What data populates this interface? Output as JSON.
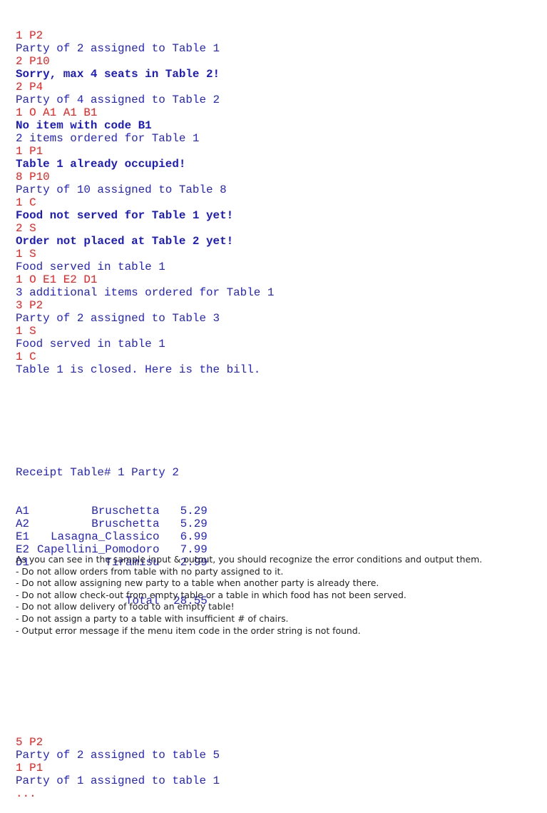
{
  "colors": {
    "input": "#ff1a1a",
    "output": "#2222dd",
    "error": "#1a1acc",
    "notes_text": "#222222"
  },
  "transcript": [
    {
      "type": "in",
      "text": "1 P2"
    },
    {
      "type": "out",
      "text": "Party of 2 assigned to Table 1"
    },
    {
      "type": "in",
      "text": "2 P10"
    },
    {
      "type": "err",
      "text": "Sorry, max 4 seats in Table 2!"
    },
    {
      "type": "in",
      "text": "2 P4"
    },
    {
      "type": "out",
      "text": "Party of 4 assigned to Table 2"
    },
    {
      "type": "in",
      "text": "1 O A1 A1 B1"
    },
    {
      "type": "err",
      "text": "No item with code B1"
    },
    {
      "type": "out",
      "text": "2 items ordered for Table 1"
    },
    {
      "type": "in",
      "text": "1 P1"
    },
    {
      "type": "err",
      "text": "Table 1 already occupied!"
    },
    {
      "type": "in",
      "text": "8 P10"
    },
    {
      "type": "out",
      "text": "Party of 10 assigned to Table 8"
    },
    {
      "type": "in",
      "text": "1 C"
    },
    {
      "type": "err",
      "text": "Food not served for Table 1 yet!"
    },
    {
      "type": "in",
      "text": "2 S"
    },
    {
      "type": "err",
      "text": "Order not placed at Table 2 yet!"
    },
    {
      "type": "in",
      "text": "1 S"
    },
    {
      "type": "out",
      "text": "Food served in table 1"
    },
    {
      "type": "in",
      "text": "1 O E1 E2 D1"
    },
    {
      "type": "out",
      "text": "3 additional items ordered for Table 1"
    },
    {
      "type": "in",
      "text": "3 P2"
    },
    {
      "type": "out",
      "text": "Party of 2 assigned to Table 3"
    },
    {
      "type": "in",
      "text": "1 S"
    },
    {
      "type": "out",
      "text": "Food served in table 1"
    },
    {
      "type": "in",
      "text": "1 C"
    },
    {
      "type": "out",
      "text": "Table 1 is closed. Here is the bill."
    }
  ],
  "receipt": {
    "header": "Receipt Table# 1 Party 2",
    "items": [
      {
        "code": "A1",
        "name": "Bruschetta",
        "price": "5.29"
      },
      {
        "code": "A2",
        "name": "Bruschetta",
        "price": "5.29"
      },
      {
        "code": "E1",
        "name": "Lasagna_Classico",
        "price": "6.99"
      },
      {
        "code": "E2",
        "name": "Capellini_Pomodoro",
        "price": "7.99"
      },
      {
        "code": "D1",
        "name": "Tiramisu",
        "price": "2.99"
      }
    ],
    "total_label": "Total",
    "total": "28.55"
  },
  "transcript_after": [
    {
      "type": "in",
      "text": "5 P2"
    },
    {
      "type": "out",
      "text": "Party of 2 assigned to table 5"
    },
    {
      "type": "in",
      "text": "1 P1"
    },
    {
      "type": "out",
      "text": "Party of 1 assigned to table 1"
    },
    {
      "type": "in",
      "text": "..."
    }
  ],
  "notes": {
    "intro": "As you can see in the sample input & output, you should recognize the error conditions and output them.",
    "rules": [
      "- Do not allow orders from table with no party assigned to it.",
      "- Do not allow assigning new party to a table when another party is already there.",
      "- Do not allow check-out from empty table or a table in which food has not been served.",
      "- Do not allow delivery of food to an empty table!",
      "- Do not assign a party to a table with insufficient # of chairs.",
      "- Output error message if the menu item code in the order string is not found."
    ]
  }
}
